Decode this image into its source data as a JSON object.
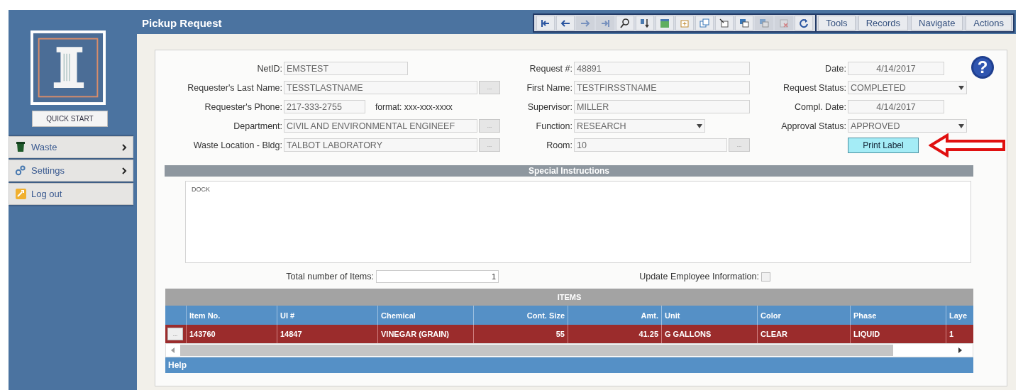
{
  "header": {
    "title": "Pickup Request"
  },
  "toolbar": {
    "icons": [
      {
        "kind": "first",
        "disabled": false
      },
      {
        "kind": "prev",
        "disabled": false
      },
      {
        "kind": "next",
        "disabled": true
      },
      {
        "kind": "last",
        "disabled": true
      },
      {
        "kind": "search",
        "disabled": false
      },
      {
        "kind": "sort",
        "disabled": false
      },
      {
        "kind": "grid",
        "disabled": false
      },
      {
        "kind": "add",
        "disabled": false
      },
      {
        "kind": "copy",
        "disabled": false
      },
      {
        "kind": "edit",
        "disabled": false
      },
      {
        "kind": "attach",
        "disabled": false
      },
      {
        "kind": "save",
        "disabled": true
      },
      {
        "kind": "delete",
        "disabled": true
      },
      {
        "kind": "refresh",
        "disabled": false
      }
    ],
    "menus": [
      "Tools",
      "Records",
      "Navigate",
      "Actions"
    ]
  },
  "sidebar": {
    "quick_start": "QUICK START",
    "items": [
      {
        "label": "Waste",
        "kind": "bin",
        "submenu": true
      },
      {
        "label": "Settings",
        "kind": "gears",
        "submenu": true
      },
      {
        "label": "Log out",
        "kind": "logout",
        "submenu": false
      }
    ]
  },
  "form": {
    "columns": [
      [
        {
          "label": "NetID:",
          "value": "EMSTEST",
          "kind": "text"
        },
        {
          "label": "Requester's Last Name:",
          "value": "TESSTLASTNAME",
          "kind": "lookup",
          "button": "..."
        },
        {
          "label": "Requester's Phone:",
          "value": "217-333-2755",
          "kind": "text",
          "note": "format: xxx-xxx-xxxx"
        },
        {
          "label": "Department:",
          "value": "CIVIL AND ENVIRONMENTAL ENGINEEF",
          "kind": "lookup",
          "button": "..."
        },
        {
          "label": "Waste Location - Bldg:",
          "value": "TALBOT LABORATORY",
          "kind": "lookup",
          "button": "..."
        }
      ],
      [
        {
          "label": "Request #:",
          "value": "48891",
          "kind": "text"
        },
        {
          "label": "First Name:",
          "value": "TESTFIRSSTNAME",
          "kind": "text"
        },
        {
          "label": "Supervisor:",
          "value": "MILLER",
          "kind": "text"
        },
        {
          "label": "Function:",
          "value": "RESEARCH",
          "kind": "select"
        },
        {
          "label": "Room:",
          "value": "10",
          "kind": "lookup",
          "button": "..."
        }
      ],
      [
        {
          "label": "Date:",
          "value": "4/14/2017",
          "kind": "date"
        },
        {
          "label": "Request Status:",
          "value": "COMPLETED",
          "kind": "select"
        },
        {
          "label": "Compl. Date:",
          "value": "4/14/2017",
          "kind": "date"
        },
        {
          "label": "Approval Status:",
          "value": "APPROVED",
          "kind": "select"
        },
        {
          "label": "Print Label",
          "kind": "button"
        }
      ]
    ]
  },
  "help_button": "?",
  "special_instructions": {
    "title": "Special Instructions",
    "value": "DOCK"
  },
  "total_items": {
    "label": "Total number of Items:",
    "value": "1"
  },
  "update_employee": {
    "label": "Update Employee Information:",
    "checked": false
  },
  "items": {
    "title": "ITEMS",
    "columns": [
      "Item No.",
      "UI #",
      "Chemical",
      "Cont. Size",
      "Amt.",
      "Unit",
      "Color",
      "Phase",
      "Laye"
    ],
    "rows": [
      {
        "selected": true,
        "button": "...",
        "cells": [
          "143760",
          "14847",
          "VINEGAR (GRAIN)",
          "55",
          "41.25",
          "G GALLONS",
          "CLEAR",
          "LIQUID",
          "1"
        ]
      }
    ],
    "help": "Help"
  }
}
